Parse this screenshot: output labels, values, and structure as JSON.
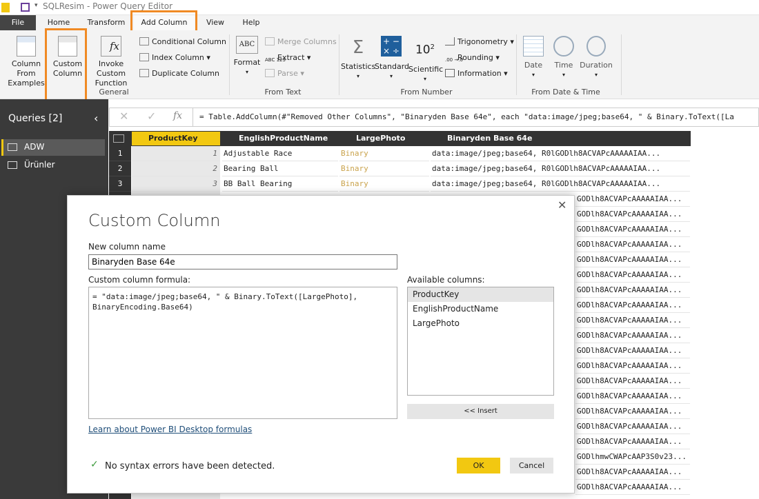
{
  "window": {
    "title": "SQLResim - Power Query Editor"
  },
  "menu": {
    "tabs": [
      "File",
      "Home",
      "Transform",
      "Add Column",
      "View",
      "Help"
    ]
  },
  "ribbon": {
    "general": {
      "col_from_examples": "Column From Examples",
      "custom_column_1": "Custom",
      "custom_column_2": "Column",
      "invoke_1": "Invoke Custom",
      "invoke_2": "Function",
      "conditional": "Conditional Column",
      "index": "Index Column",
      "duplicate": "Duplicate Column",
      "label": "General"
    },
    "from_text": {
      "format": "Format",
      "merge": "Merge Columns",
      "extract": "Extract",
      "parse": "Parse",
      "label": "From Text"
    },
    "from_number": {
      "statistics": "Statistics",
      "standard": "Standard",
      "scientific": "Scientific",
      "trig": "Trigonometry",
      "rounding": "Rounding",
      "information": "Information",
      "label": "From Number"
    },
    "from_date": {
      "date": "Date",
      "time": "Time",
      "duration": "Duration",
      "label": "From Date & Time"
    }
  },
  "queries": {
    "title": "Queries [2]",
    "items": [
      "ADW",
      "Ürünler"
    ]
  },
  "formula": {
    "text": "= Table.AddColumn(#\"Removed Other Columns\", \"Binaryden Base 64e\", each \"data:image/jpeg;base64, \" & Binary.ToText([La"
  },
  "grid": {
    "columns": [
      "ProductKey",
      "EnglishProductName",
      "LargePhoto",
      "Binaryden Base 64e"
    ],
    "rows": [
      {
        "n": "1",
        "key": "1",
        "name": "Adjustable Race",
        "photo": "Binary",
        "b64": "data:image/jpeg;base64, R0lGODlh8ACVAPcAAAAAIAA..."
      },
      {
        "n": "2",
        "key": "2",
        "name": "Bearing Ball",
        "photo": "Binary",
        "b64": "data:image/jpeg;base64, R0lGODlh8ACVAPcAAAAAIAA..."
      },
      {
        "n": "3",
        "key": "3",
        "name": "BB Ball Bearing",
        "photo": "Binary",
        "b64": "data:image/jpeg;base64, R0lGODlh8ACVAPcAAAAAIAA..."
      }
    ],
    "partial": [
      "GODlh8ACVAPcAAAAAIAA...",
      "GODlh8ACVAPcAAAAAIAA...",
      "GODlh8ACVAPcAAAAAIAA...",
      "GODlh8ACVAPcAAAAAIAA...",
      "GODlh8ACVAPcAAAAAIAA...",
      "GODlh8ACVAPcAAAAAIAA...",
      "GODlh8ACVAPcAAAAAIAA...",
      "GODlh8ACVAPcAAAAAIAA...",
      "GODlh8ACVAPcAAAAAIAA...",
      "GODlh8ACVAPcAAAAAIAA...",
      "GODlh8ACVAPcAAAAAIAA...",
      "GODlh8ACVAPcAAAAAIAA...",
      "GODlh8ACVAPcAAAAAIAA...",
      "GODlh8ACVAPcAAAAAIAA...",
      "GODlh8ACVAPcAAAAAIAA...",
      "GODlh8ACVAPcAAAAAIAA...",
      "GODlh8ACVAPcAAAAAIAA...",
      "GODlhmwCWAPcAAP3S0v23...",
      "GODlh8ACVAPcAAAAAIAA...",
      "GODlh8ACVAPcAAAAAIAA..."
    ]
  },
  "dialog": {
    "title": "Custom Column",
    "name_label": "New column name",
    "name_value": "Binaryden Base 64e",
    "formula_label": "Custom column formula:",
    "formula_line1": "= \"data:image/jpeg;base64, \" & Binary.ToText([LargePhoto],",
    "formula_line2": "BinaryEncoding.Base64)",
    "avail_label": "Available columns:",
    "avail": [
      "ProductKey",
      "EnglishProductName",
      "LargePhoto"
    ],
    "insert": "<< Insert",
    "learn": "Learn about Power BI Desktop formulas",
    "status": "No syntax errors have been detected.",
    "ok": "OK",
    "cancel": "Cancel"
  },
  "colors": {
    "accent": "#f2c811",
    "highlight": "#f08a24",
    "binary": "#c9a24a"
  }
}
